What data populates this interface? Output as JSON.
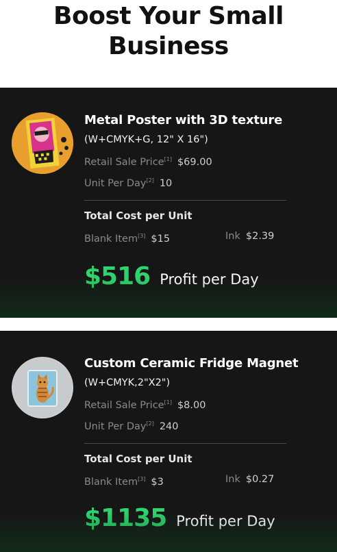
{
  "headline": {
    "line1": "Boost Your Small",
    "line2": "Business"
  },
  "products": [
    {
      "title": "Metal Poster with 3D texture",
      "spec": "(W+CMYK+G, 12\" X 16\")",
      "retail_label": "Retail Sale Price",
      "retail_sup": "[1]",
      "retail_value": "$69.00",
      "units_label": "Unit Per Day",
      "units_sup": "[2]",
      "units_value": "10",
      "cost_title": "Total Cost per Unit",
      "blank_label": "Blank Item",
      "blank_sup": "[3]",
      "blank_value": "$15",
      "ink_label": "Ink",
      "ink_value": "$2.39",
      "profit_value": "$516",
      "profit_label": "Profit per Day"
    },
    {
      "title": "Custom Ceramic Fridge Magnet",
      "spec": "(W+CMYK,2\"X2\")",
      "retail_label": "Retail Sale Price",
      "retail_sup": "[1]",
      "retail_value": "$8.00",
      "units_label": "Unit Per Day",
      "units_sup": "[2]",
      "units_value": "240",
      "cost_title": "Total Cost per Unit",
      "blank_label": "Blank Item",
      "blank_sup": "[3]",
      "blank_value": "$3",
      "ink_label": "Ink",
      "ink_value": "$0.27",
      "profit_value": "$1135",
      "profit_label": "Profit per Day"
    }
  ],
  "colors": {
    "card_background": "#161616",
    "profit_accent": "#2fd36d",
    "headline_text": "#111111"
  },
  "icons": [
    "metal-poster-thumbnail",
    "fridge-magnet-cat-thumbnail"
  ]
}
